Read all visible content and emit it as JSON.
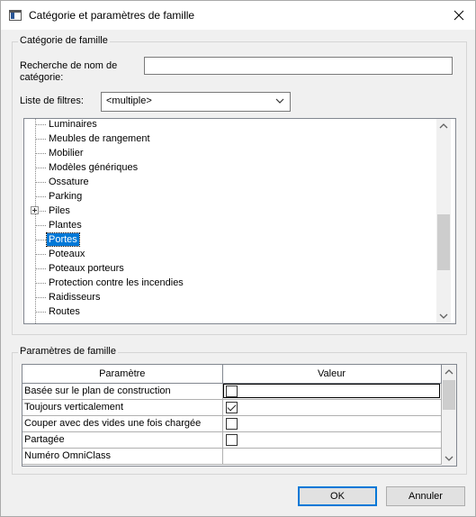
{
  "window": {
    "title": "Catégorie et paramètres de famille",
    "close_icon": "close-icon"
  },
  "category_group": {
    "label": "Catégorie de famille",
    "search_label_line1": "Recherche de nom de",
    "search_label_line2": "catégorie:",
    "search_value": "",
    "filter_label": "Liste de filtres:",
    "filter_value": "<multiple>",
    "tree_items": [
      {
        "label": "Luminaires",
        "expandable": false,
        "selected": false
      },
      {
        "label": "Meubles de rangement",
        "expandable": false,
        "selected": false
      },
      {
        "label": "Mobilier",
        "expandable": false,
        "selected": false
      },
      {
        "label": "Modèles génériques",
        "expandable": false,
        "selected": false
      },
      {
        "label": "Ossature",
        "expandable": false,
        "selected": false
      },
      {
        "label": "Parking",
        "expandable": false,
        "selected": false
      },
      {
        "label": "Piles",
        "expandable": true,
        "selected": false
      },
      {
        "label": "Plantes",
        "expandable": false,
        "selected": false
      },
      {
        "label": "Portes",
        "expandable": false,
        "selected": true
      },
      {
        "label": "Poteaux",
        "expandable": false,
        "selected": false
      },
      {
        "label": "Poteaux porteurs",
        "expandable": false,
        "selected": false
      },
      {
        "label": "Protection contre les incendies",
        "expandable": false,
        "selected": false
      },
      {
        "label": "Raidisseurs",
        "expandable": false,
        "selected": false
      },
      {
        "label": "Routes",
        "expandable": false,
        "selected": false
      }
    ]
  },
  "params_group": {
    "label": "Paramètres de famille",
    "col_param": "Paramètre",
    "col_value": "Valeur",
    "rows": [
      {
        "name": "Basée sur le plan de construction",
        "type": "checkbox",
        "checked": false
      },
      {
        "name": "Toujours verticalement",
        "type": "checkbox",
        "checked": true
      },
      {
        "name": "Couper avec des vides une fois chargée",
        "type": "checkbox",
        "checked": false
      },
      {
        "name": "Partagée",
        "type": "checkbox",
        "checked": false
      },
      {
        "name": "Numéro OmniClass",
        "type": "text",
        "value": ""
      }
    ]
  },
  "buttons": {
    "ok": "OK",
    "cancel": "Annuler"
  },
  "colors": {
    "selection": "#0078d7",
    "default_button_border": "#0078d7"
  }
}
